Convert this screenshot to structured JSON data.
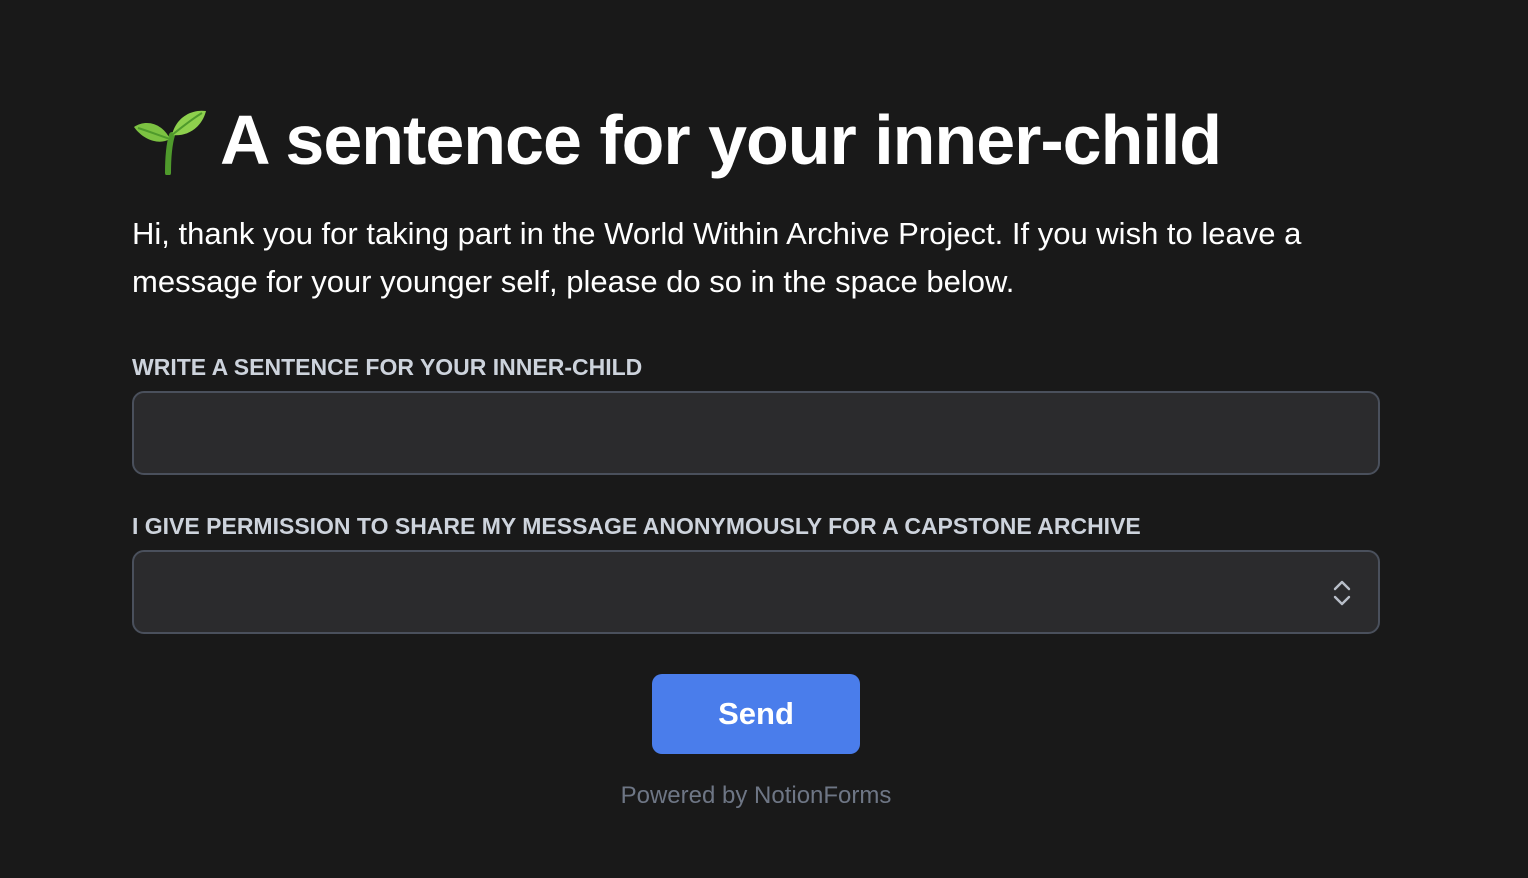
{
  "form": {
    "title": "A sentence for your inner-child",
    "title_icon": "sprout-icon",
    "description": "Hi, thank you for taking part in the World Within Archive Project. If you wish to leave a message for your younger self, please do so in the space below.",
    "fields": [
      {
        "label": "WRITE A SENTENCE FOR YOUR INNER-CHILD",
        "type": "text",
        "value": "",
        "placeholder": ""
      },
      {
        "label": "I GIVE PERMISSION TO SHARE MY MESSAGE ANONYMOUSLY FOR A CAPSTONE ARCHIVE",
        "type": "select",
        "selected": "",
        "icon": "chevron-up-down-icon"
      }
    ],
    "submit_label": "Send",
    "footer": "Powered by NotionForms"
  },
  "colors": {
    "background": "#191919",
    "input_background": "#2b2b2d",
    "input_border": "#4a505c",
    "label": "#cdd3dc",
    "accent": "#4a7deb",
    "footer_text": "#6e7685"
  }
}
